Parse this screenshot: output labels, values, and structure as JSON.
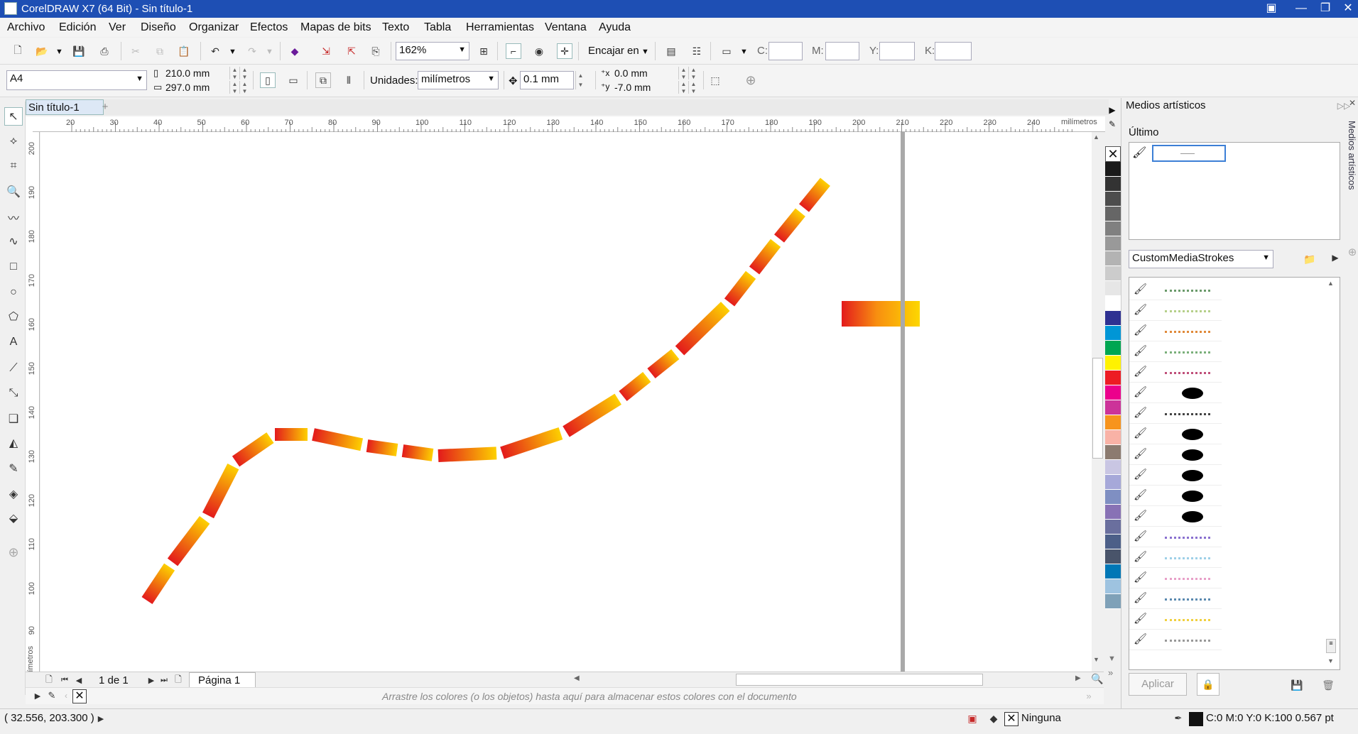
{
  "app": {
    "title": "CorelDRAW X7 (64 Bit) - Sin título-1"
  },
  "menu": [
    "Archivo",
    "Edición",
    "Ver",
    "Diseño",
    "Organizar",
    "Efectos",
    "Mapas de bits",
    "Texto",
    "Tabla",
    "Herramientas",
    "Ventana",
    "Ayuda"
  ],
  "toolbar": {
    "zoom": "162%",
    "snap": "Encajar en",
    "c_label": "C:",
    "m_label": "M:",
    "y_label": "Y:",
    "k_label": "K:"
  },
  "propbar": {
    "page_size": "A4",
    "width": "210.0 mm",
    "height": "297.0 mm",
    "units_label": "Unidades:",
    "units_value": "milímetros",
    "nudge": "0.1 mm",
    "dup_x": "0.0 mm",
    "dup_y": "-7.0 mm"
  },
  "document": {
    "tab": "Sin título-1",
    "page_counter": "1 de 1",
    "page_tab": "Página 1"
  },
  "rulers": {
    "units": "milímetros",
    "h_ticks": [
      "20",
      "30",
      "40",
      "50",
      "60",
      "70",
      "80",
      "90",
      "100",
      "110",
      "120",
      "130",
      "140",
      "150",
      "160",
      "170",
      "180",
      "190",
      "200",
      "210",
      "220",
      "230",
      "240"
    ],
    "v_ticks": [
      "200",
      "190",
      "180",
      "170",
      "160",
      "150",
      "140",
      "130",
      "120",
      "110",
      "100",
      "90"
    ]
  },
  "colorhint": "Arrastre los colores (o los objetos) hasta aquí para almacenar estos colores con el documento",
  "palette": [
    "#1a1a1a",
    "#333333",
    "#4d4d4d",
    "#666666",
    "#808080",
    "#999999",
    "#b3b3b3",
    "#cccccc",
    "#e6e6e6",
    "#ffffff",
    "#2e3192",
    "#0096d6",
    "#00a651",
    "#fff200",
    "#ed1c24",
    "#ec008c",
    "#cc3399",
    "#f7941d",
    "#f9b2a6",
    "#8c7b70",
    "#c9c6e3",
    "#a6a8d9",
    "#7f8fc2",
    "#8872b5",
    "#6a6f9e",
    "#4c5f88",
    "#49546a",
    "#0077b6",
    "#9ec3e0",
    "#7fa1b8"
  ],
  "docker": {
    "title": "Medios artísticos",
    "recent_label": "Último",
    "library": "CustomMediaStrokes",
    "apply_label": "Aplicar",
    "side_tab": "Medios artísticos",
    "strokes": [
      "grass-stroke",
      "dots-stroke",
      "flowers-stroke",
      "vine-stroke",
      "pink-flowers-stroke",
      "splat-stroke",
      "wisp-stroke",
      "blob-stroke",
      "blob2-stroke",
      "brush-stroke",
      "leaf-stroke",
      "swoosh-stroke",
      "color-dots-stroke",
      "snowflake-stroke",
      "pink-stars-stroke",
      "bead-stroke",
      "yellow-stars-stroke",
      "thin-line-stroke"
    ]
  },
  "status": {
    "coords": "( 32.556, 203.300 )",
    "fill_value": "Ninguna",
    "outline_value": "C:0 M:0 Y:0 K:100  0.567 pt"
  }
}
